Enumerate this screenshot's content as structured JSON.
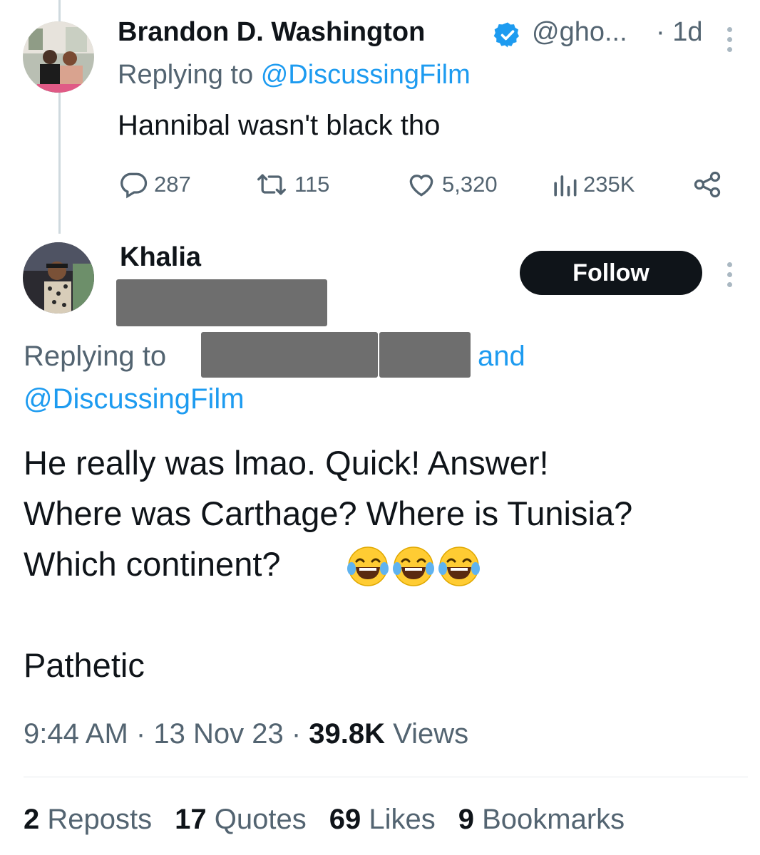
{
  "reply_tweet": {
    "author_name": "Brandon D. Washington",
    "handle": "@gho...",
    "time_ago": "· 1d",
    "replying_prefix": "Replying to",
    "replying_handle": "@DiscussingFilm",
    "text": "Hannibal wasn't black tho",
    "actions": {
      "replies": "287",
      "reposts": "115",
      "likes": "5,320",
      "views": "235K"
    }
  },
  "main_tweet": {
    "author_name": "Khalia",
    "follow_label": "Follow",
    "replying_prefix": "Replying to",
    "replying_and": "and",
    "replying_handle": "@DiscussingFilm",
    "text_line1": "He really was lmao. Quick! Answer!",
    "text_line2": "Where was Carthage?  Where is Tunisia?",
    "text_line3": "Which continent?",
    "text_line4": "Pathetic",
    "meta": {
      "time": "9:44 AM",
      "sep1": "·",
      "date": "13 Nov 23",
      "sep2": "·",
      "views_count": "39.8K",
      "views_label": "Views"
    },
    "stats": {
      "reposts_count": "2",
      "reposts_label": "Reposts",
      "quotes_count": "17",
      "quotes_label": "Quotes",
      "likes_count": "69",
      "likes_label": "Likes",
      "bookmarks_count": "9",
      "bookmarks_label": "Bookmarks"
    }
  },
  "icons": [
    "verified-badge-icon",
    "more-options-icon",
    "reply-icon",
    "repost-icon",
    "like-icon",
    "views-icon",
    "share-icon",
    "laughing-tears-emoji"
  ],
  "colors": {
    "link": "#1d9bf0",
    "muted": "#536471",
    "text": "#0f1419",
    "follow_bg": "#0f1419"
  }
}
